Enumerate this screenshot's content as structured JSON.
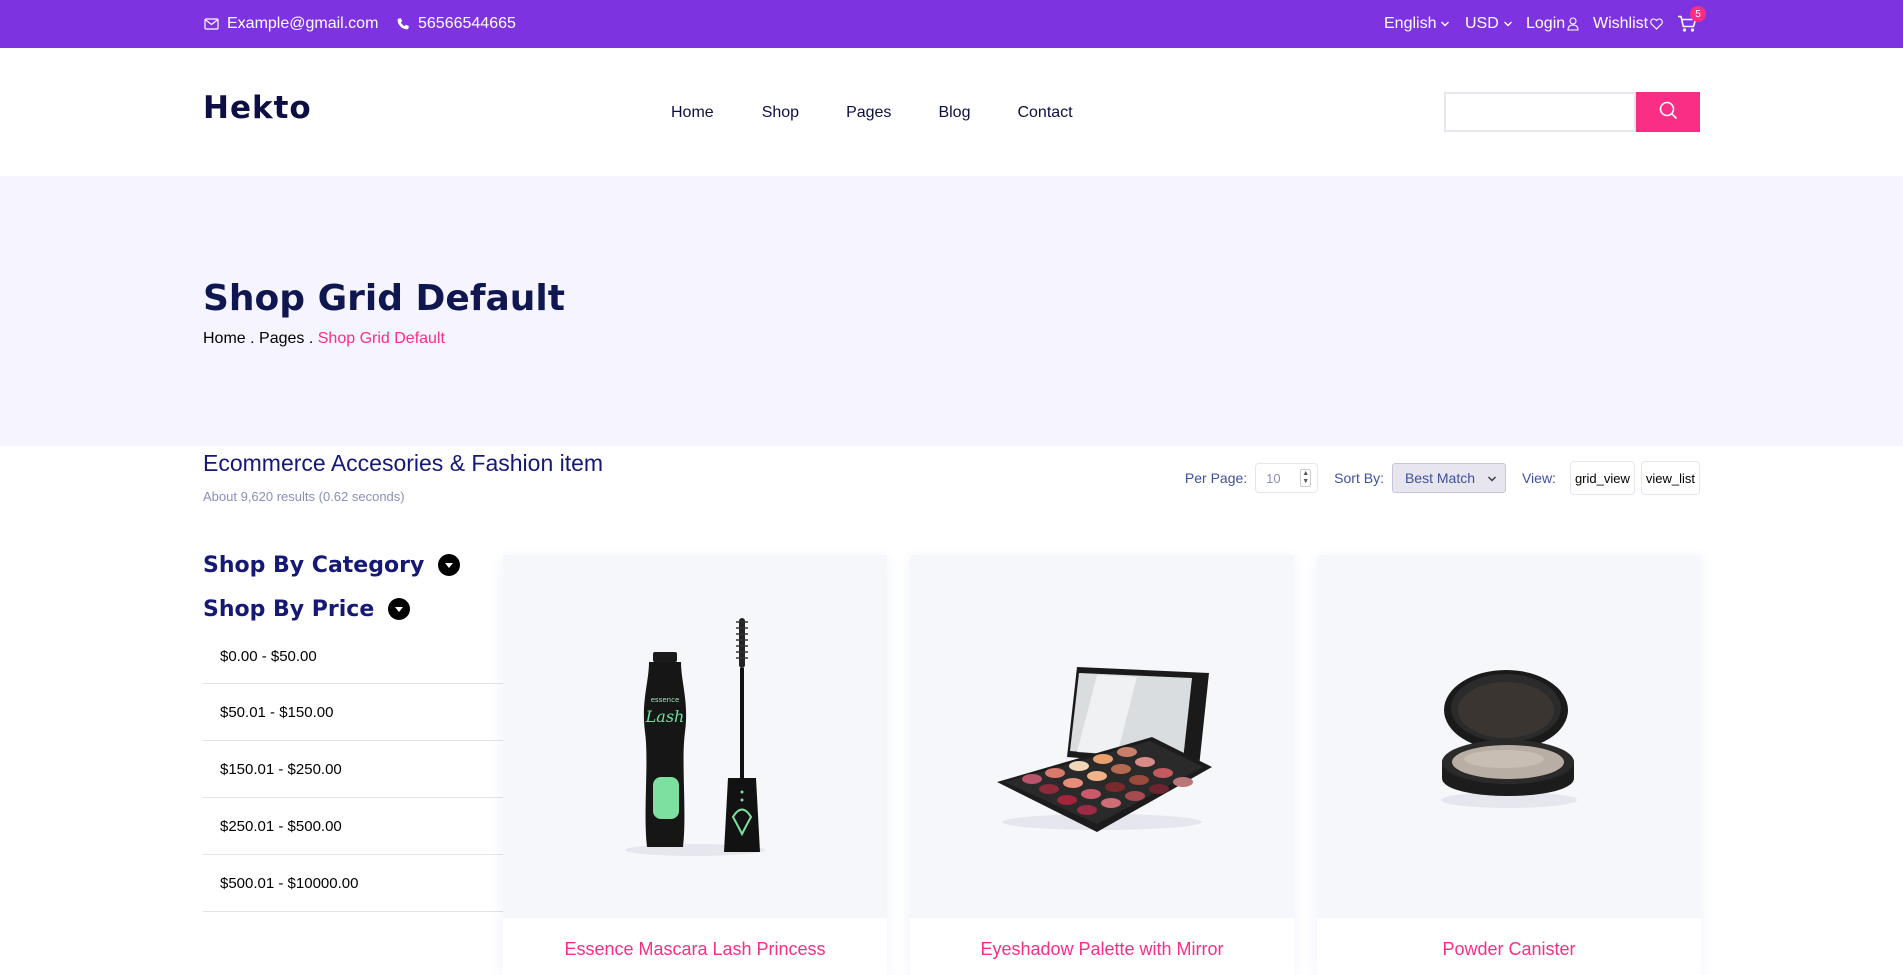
{
  "topbar": {
    "email": "Example@gmail.com",
    "phone": "56566544665",
    "language": "English",
    "currency": "USD",
    "login": "Login",
    "wishlist": "Wishlist",
    "cart_count": "5"
  },
  "header": {
    "logo": "Hekto",
    "nav": [
      "Home",
      "Shop",
      "Pages",
      "Blog",
      "Contact"
    ],
    "search_value": ""
  },
  "banner": {
    "title": "Shop Grid Default",
    "breadcrumb": [
      "Home",
      ".",
      "Pages",
      ".",
      "Shop Grid Default"
    ]
  },
  "toolbar": {
    "heading": "Ecommerce Accesories & Fashion item",
    "results": "About 9,620 results (0.62 seconds)",
    "per_page_label": "Per Page:",
    "per_page_value": "10",
    "sort_label": "Sort By:",
    "sort_value": "Best Match",
    "view_label": "View:",
    "view_grid": "grid_view",
    "view_list": "view_list"
  },
  "sidebar": {
    "category_heading": "Shop By Category",
    "price_heading": "Shop By Price",
    "prices": [
      "$0.00 - $50.00",
      "$50.01 - $150.00",
      "$150.01 - $250.00",
      "$250.01 - $500.00",
      "$500.01 - $10000.00"
    ]
  },
  "products": [
    {
      "title": "Essence Mascara Lash Princess"
    },
    {
      "title": "Eyeshadow Palette with Mirror"
    },
    {
      "title": "Powder Canister"
    }
  ],
  "colors": {
    "topbar": "#7E33E0",
    "accent": "#FB2E86",
    "navy": "#151875",
    "banner_bg": "#F6F5FF"
  }
}
